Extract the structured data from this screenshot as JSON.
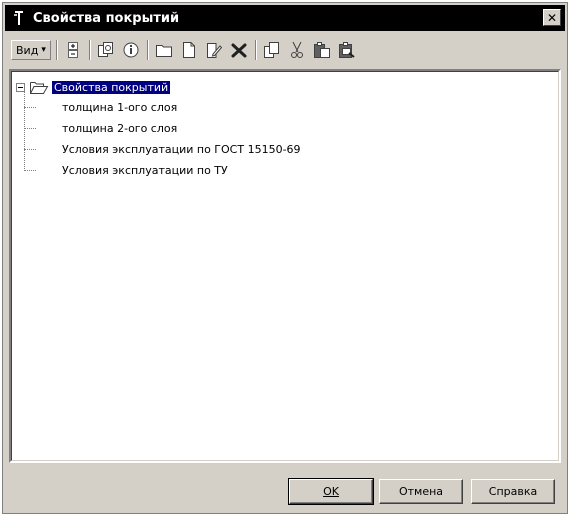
{
  "window": {
    "title": "Свойства покрытий",
    "close_glyph": "✕"
  },
  "toolbar": {
    "view_label": "Вид",
    "view_arrow": "▾",
    "icons": [
      "expand-collapse-icon",
      "copy-properties-icon",
      "info-icon",
      "new-folder-icon",
      "new-item-icon",
      "edit-icon",
      "delete-icon",
      "duplicate-icon",
      "cut-icon",
      "paste-icon",
      "paste-special-icon"
    ]
  },
  "tree": {
    "root": {
      "label": "Свойства покрытий"
    },
    "children": [
      {
        "label": "толщина 1-ого слоя"
      },
      {
        "label": "толщина 2-ого слоя"
      },
      {
        "label": "Условия эксплуатации по ГОСТ 15150-69"
      },
      {
        "label": "Условия эксплуатации по ТУ"
      }
    ]
  },
  "buttons": {
    "ok": "OK",
    "cancel": "Отмена",
    "help": "Справка"
  },
  "colors": {
    "titlebar": "#000000",
    "selection": "#000080",
    "dialog_bg": "#d4d0c8"
  }
}
